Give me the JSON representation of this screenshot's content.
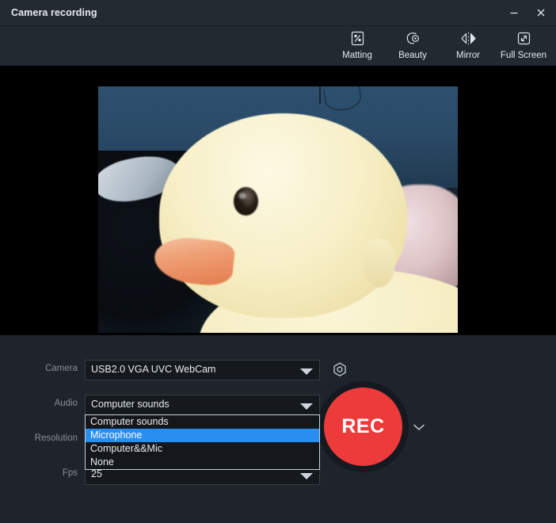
{
  "window": {
    "title": "Camera recording",
    "minimize_label": "Minimize",
    "close_label": "Close",
    "bg_color": "#22272e",
    "titlebar_color": "#242a32"
  },
  "toolbar": {
    "items": [
      {
        "label": "Matting",
        "icon": "matting-icon"
      },
      {
        "label": "Beauty",
        "icon": "beauty-icon"
      },
      {
        "label": "Mirror",
        "icon": "mirror-icon"
      },
      {
        "label": "Full Screen",
        "icon": "fullscreen-icon"
      }
    ]
  },
  "preview": {
    "alt": "Live camera preview showing a yellow rubber duck toy against a blue background",
    "background_color": "#000000"
  },
  "settings": {
    "camera": {
      "label": "Camera",
      "value": "USB2.0 VGA UVC WebCam",
      "settings_icon": "gear-icon"
    },
    "audio": {
      "label": "Audio",
      "value": "Computer sounds",
      "settings_icon": "gear-icon",
      "options": [
        "Computer sounds",
        "Microphone",
        "Computer&&Mic",
        "None"
      ],
      "selected_option": "Microphone",
      "highlight_color": "#2a8ef0",
      "open": true
    },
    "resolution": {
      "label": "Resolution",
      "value": ""
    },
    "fps": {
      "label": "Fps",
      "value": "25"
    }
  },
  "record": {
    "label": "REC",
    "color": "#ed3b3b",
    "dropdown_icon": "chevron-down-icon"
  }
}
